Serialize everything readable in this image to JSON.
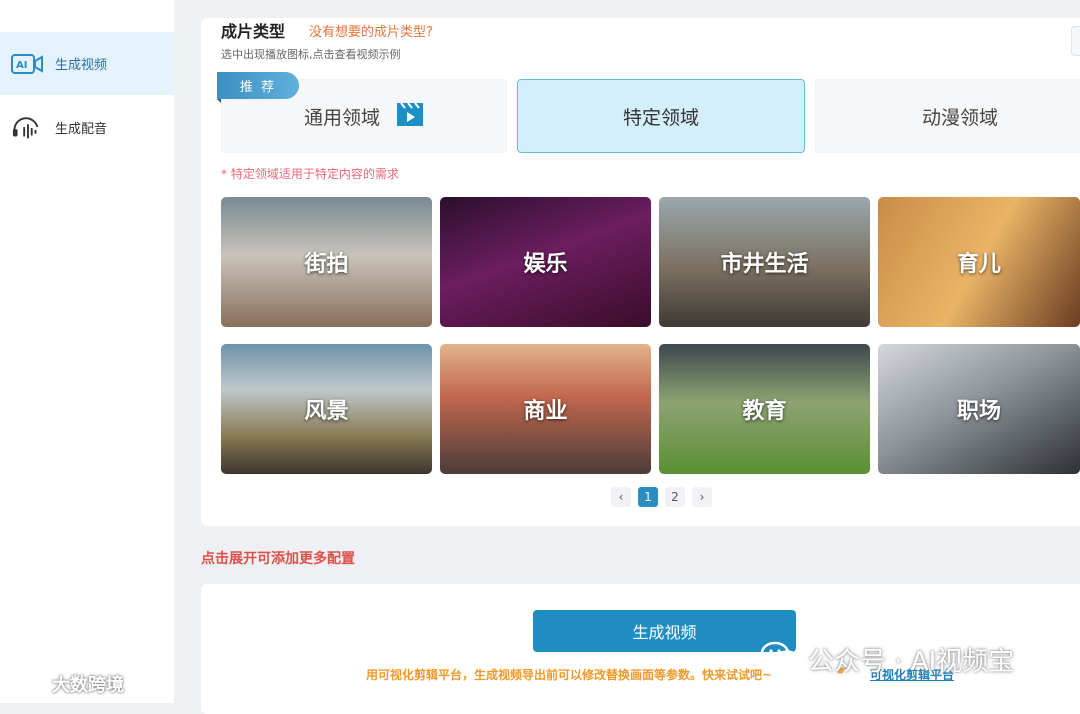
{
  "sidebar": {
    "items": [
      {
        "label": "生成视频",
        "icon": "ai-video-icon",
        "active": true
      },
      {
        "label": "生成配音",
        "icon": "voice-wave-icon",
        "active": false
      }
    ]
  },
  "section": {
    "title": "成片类型",
    "link": "没有想要的成片类型?",
    "subtitle": "选中出现播放图标,点击查看视频示例"
  },
  "badge": "推 荐",
  "tabs": [
    {
      "label": "通用领域",
      "active": false
    },
    {
      "label": "特定领域",
      "active": true
    },
    {
      "label": "动漫领域",
      "active": false
    }
  ],
  "note": "* 特定领域适用于特定内容的需求",
  "categories": [
    {
      "label": "街拍"
    },
    {
      "label": "娱乐"
    },
    {
      "label": "市井生活"
    },
    {
      "label": "育儿"
    },
    {
      "label": "风景"
    },
    {
      "label": "商业"
    },
    {
      "label": "教育"
    },
    {
      "label": "职场"
    }
  ],
  "pagination": {
    "prev": "‹",
    "pages": [
      "1",
      "2"
    ],
    "current": "1",
    "next": "›"
  },
  "expand_text": "点击展开可添加更多配置",
  "generate_button": "生成视频",
  "hint": "用可视化剪辑平台，生成视频导出前可以修改替换画面等参数。快来试试吧~",
  "hint_link": "可视化剪辑平台",
  "watermarks": {
    "brand": "大数跨境",
    "account": "公众号 · AI视频宝"
  },
  "colors": {
    "accent": "#1f8dc1",
    "active_tab": "#d4effc",
    "warning": "#e0504a"
  }
}
